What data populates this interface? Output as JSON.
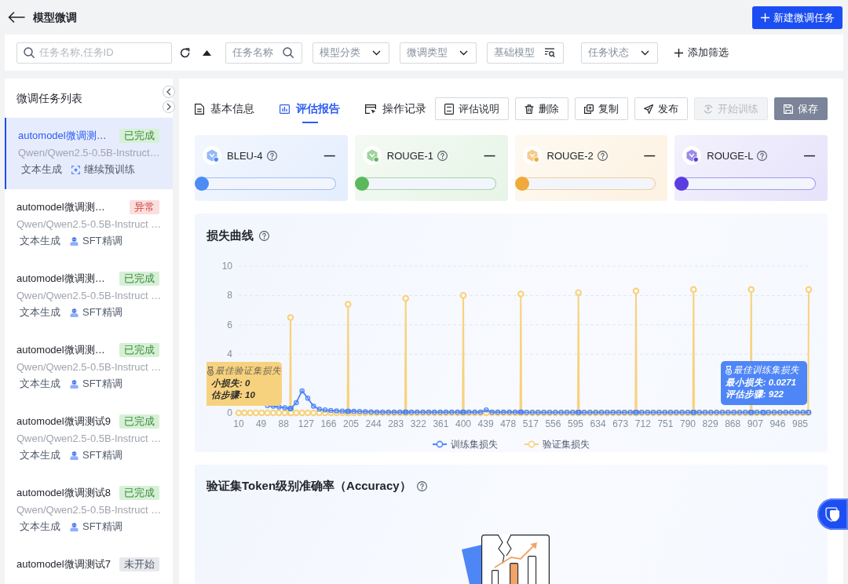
{
  "header": {
    "title": "模型微调",
    "new_button": "新建微调任务"
  },
  "filter_bar": {
    "search": {
      "placeholder": "任务名称,任务ID"
    },
    "filters": [
      {
        "kind": "search",
        "placeholder": "任务名称"
      },
      {
        "kind": "select",
        "placeholder": "模型分类"
      },
      {
        "kind": "select",
        "placeholder": "微调类型"
      },
      {
        "kind": "picker",
        "placeholder": "基础模型"
      },
      {
        "kind": "select",
        "placeholder": "任务状态"
      }
    ],
    "add_filter": "添加筛选"
  },
  "sidebar": {
    "title": "微调任务列表",
    "items": [
      {
        "name": "automodel微调测…",
        "selected": true,
        "status": {
          "label": "已完成",
          "kind": "done"
        },
        "model": "Qwen/Qwen2.5-0.5B-Instruct…",
        "task_type": "文本生成",
        "method": {
          "label": "继续预训练",
          "kind": "pretrain"
        }
      },
      {
        "name": "automodel微调测…",
        "selected": false,
        "status": {
          "label": "异常",
          "kind": "error"
        },
        "model": "Qwen/Qwen2.5-0.5B-Instruct …",
        "task_type": "文本生成",
        "method": {
          "label": "SFT精调",
          "kind": "sft"
        }
      },
      {
        "name": "automodel微调测…",
        "selected": false,
        "status": {
          "label": "已完成",
          "kind": "done"
        },
        "model": "Qwen/Qwen2.5-0.5B-Instruct …",
        "task_type": "文本生成",
        "method": {
          "label": "SFT精调",
          "kind": "sft"
        }
      },
      {
        "name": "automodel微调测…",
        "selected": false,
        "status": {
          "label": "已完成",
          "kind": "done"
        },
        "model": "Qwen/Qwen2.5-0.5B-Instruct …",
        "task_type": "文本生成",
        "method": {
          "label": "SFT精调",
          "kind": "sft"
        }
      },
      {
        "name": "automodel微调测试9",
        "selected": false,
        "status": {
          "label": "已完成",
          "kind": "done"
        },
        "model": "Qwen/Qwen2.5-0.5B-Instruct …",
        "task_type": "文本生成",
        "method": {
          "label": "SFT精调",
          "kind": "sft"
        }
      },
      {
        "name": "automodel微调测试8",
        "selected": false,
        "status": {
          "label": "已完成",
          "kind": "done"
        },
        "model": "Qwen/Qwen2.5-0.5B-Instruct …",
        "task_type": "文本生成",
        "method": {
          "label": "SFT精调",
          "kind": "sft"
        }
      },
      {
        "name": "automodel微调测试7",
        "selected": false,
        "status": {
          "label": "未开始",
          "kind": "pending"
        }
      }
    ]
  },
  "tabs": [
    {
      "label": "基本信息",
      "selected": false
    },
    {
      "label": "评估报告",
      "selected": true
    },
    {
      "label": "操作记录",
      "selected": false
    }
  ],
  "actions": [
    {
      "label": "评估说明",
      "kind": "outline",
      "disabled": false
    },
    {
      "label": "删除",
      "kind": "outline",
      "disabled": false
    },
    {
      "label": "复制",
      "kind": "outline",
      "disabled": false
    },
    {
      "label": "发布",
      "kind": "outline",
      "disabled": false
    },
    {
      "label": "开始训练",
      "kind": "outline",
      "disabled": true
    },
    {
      "label": "保存",
      "kind": "filled",
      "disabled": false
    }
  ],
  "metrics": [
    {
      "name": "BLEU-4",
      "value": "—",
      "level": 0,
      "color": "#4d8bf5"
    },
    {
      "name": "ROUGE-1",
      "value": "—",
      "level": 0,
      "color": "#5cb85c"
    },
    {
      "name": "ROUGE-2",
      "value": "—",
      "level": 0,
      "color": "#f0a93b"
    },
    {
      "name": "ROUGE-L",
      "value": "—",
      "level": 0,
      "color": "#5a3ee0"
    }
  ],
  "loss_chart": {
    "title": "损失曲线",
    "chart_data": {
      "type": "line",
      "x": [
        10,
        20,
        30,
        40,
        50,
        60,
        70,
        80,
        90,
        99,
        100,
        101,
        110,
        120,
        130,
        140,
        150,
        160,
        170,
        180,
        190,
        199,
        200,
        201,
        210,
        220,
        230,
        240,
        250,
        260,
        270,
        280,
        290,
        299,
        300,
        301,
        310,
        320,
        330,
        340,
        350,
        360,
        370,
        380,
        390,
        399,
        400,
        401,
        410,
        420,
        430,
        440,
        450,
        460,
        470,
        480,
        490,
        499,
        500,
        501,
        510,
        520,
        530,
        540,
        550,
        560,
        570,
        580,
        590,
        599,
        600,
        601,
        610,
        620,
        630,
        640,
        650,
        660,
        670,
        680,
        690,
        699,
        700,
        701,
        710,
        720,
        730,
        740,
        750,
        760,
        770,
        780,
        790,
        799,
        800,
        801,
        810,
        820,
        830,
        840,
        850,
        860,
        870,
        880,
        890,
        899,
        900,
        901,
        910,
        920,
        922,
        930,
        940,
        950,
        960,
        970,
        980,
        990,
        999,
        1000
      ],
      "xlim": [
        10,
        1000
      ],
      "ylim": [
        0,
        10
      ],
      "xticks": [
        10,
        49,
        88,
        127,
        166,
        205,
        244,
        283,
        322,
        361,
        400,
        439,
        478,
        517,
        556,
        595,
        634,
        673,
        712,
        751,
        790,
        829,
        868,
        907,
        946,
        985
      ],
      "yticks": [
        0,
        4,
        6,
        8,
        10
      ],
      "grid": true,
      "legend": "bottom",
      "series": [
        {
          "name": "训练集损失",
          "color": "#4f86f7",
          "marker": "circle",
          "values": [
            null,
            null,
            null,
            null,
            null,
            0.5,
            0.45,
            0.4,
            0.35,
            0.3,
            0.3,
            0.3,
            0.7,
            1.5,
            1,
            0.45,
            0.25,
            0.2,
            0.16,
            0.14,
            0.12,
            0.11,
            0.11,
            0.11,
            0.1,
            0.09,
            0.08,
            0.07,
            0.06,
            0.06,
            0.05,
            0.05,
            0.05,
            0.05,
            0.05,
            0.05,
            0.05,
            0.05,
            0.05,
            0.05,
            0.05,
            0.05,
            0.05,
            0.05,
            0.05,
            0.05,
            0.05,
            0.05,
            0.05,
            0.05,
            0.05,
            0.2,
            0.05,
            0.05,
            0.05,
            0.05,
            0.05,
            0.05,
            0.05,
            0.05,
            0.04,
            0.04,
            0.04,
            0.04,
            0.04,
            0.04,
            0.04,
            0.04,
            0.04,
            0.04,
            0.04,
            0.04,
            0.04,
            0.04,
            0.04,
            0.04,
            0.04,
            0.04,
            0.04,
            0.04,
            0.04,
            0.04,
            0.04,
            0.04,
            0.04,
            0.04,
            0.04,
            0.04,
            0.04,
            0.04,
            0.04,
            0.04,
            0.04,
            0.04,
            0.04,
            0.04,
            0.04,
            0.04,
            0.04,
            0.04,
            0.04,
            0.04,
            0.04,
            0.04,
            0.04,
            0.04,
            0.04,
            0.04,
            0.04,
            0.04,
            0.03,
            0.04,
            0.04,
            0.04,
            0.04,
            0.04,
            0.04,
            0.04,
            0.04,
            0.04
          ]
        },
        {
          "name": "验证集损失",
          "color": "#f7d27e",
          "marker": "circle",
          "values": [
            0,
            0,
            0,
            0,
            0,
            0,
            0,
            0,
            0,
            0,
            6.5,
            0,
            0,
            0,
            0,
            0,
            0,
            0,
            0,
            0,
            0,
            0,
            7.4,
            0,
            0,
            0,
            0,
            0,
            0,
            0,
            0,
            0,
            0,
            0,
            7.8,
            0,
            0,
            0,
            0,
            0,
            0,
            0,
            0,
            0,
            0,
            0,
            8,
            0,
            0,
            0,
            0,
            0,
            0,
            0,
            0,
            0,
            0,
            0,
            8.1,
            0,
            0,
            0,
            0,
            0,
            0,
            0,
            0,
            0,
            0,
            0,
            8.2,
            0,
            0,
            0,
            0,
            0,
            0,
            0,
            0,
            0,
            0,
            0,
            8.3,
            0,
            0,
            0,
            0,
            0,
            0,
            0,
            0,
            0,
            0,
            0,
            8.4,
            0,
            0,
            0,
            0,
            0,
            0,
            0,
            0,
            0,
            0,
            0,
            8.4,
            0,
            0,
            0,
            0,
            0,
            0,
            0,
            0,
            0,
            0,
            0,
            0,
            8.4
          ]
        }
      ]
    },
    "tooltips": [
      {
        "title": "最佳验证集损失",
        "lines": [
          "小损失: 0",
          "估步骤: 10"
        ],
        "color": "#f7d27e"
      },
      {
        "title": "最佳训练集损失",
        "lines": [
          "最小损失: 0.0271",
          "评估步骤: 922"
        ],
        "color": "#4f86f7"
      }
    ]
  },
  "accuracy_chart": {
    "title": "验证集Token级别准确率（Accuracy）"
  }
}
